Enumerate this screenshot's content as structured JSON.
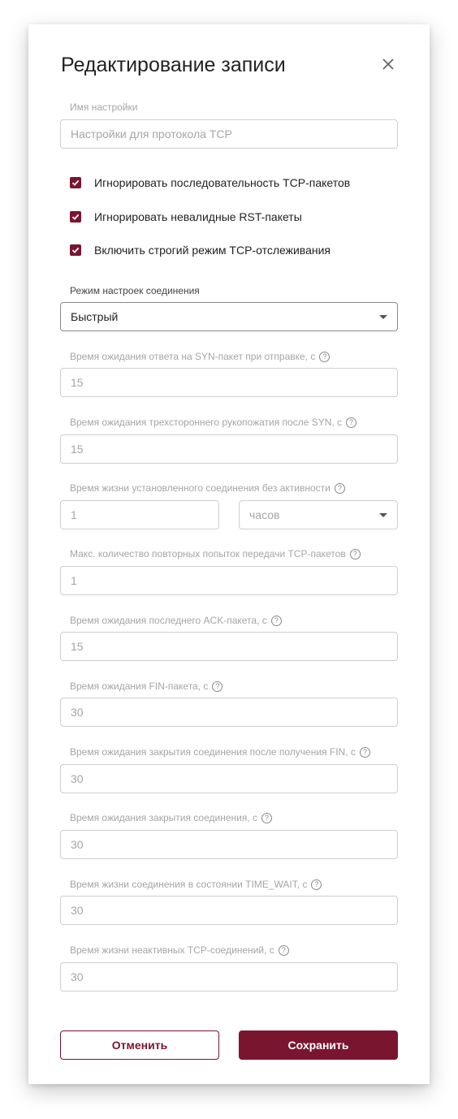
{
  "dialog": {
    "title": "Редактирование записи",
    "close_icon": "close-icon"
  },
  "name_field": {
    "label": "Имя настройки",
    "placeholder": "Настройки для протокола TCP"
  },
  "checkboxes": [
    {
      "label": "Игнорировать последовательность TCP-пакетов",
      "checked": true
    },
    {
      "label": "Игнорировать невалидные RST-пакеты",
      "checked": true
    },
    {
      "label": "Включить строгий режим TCP-отслеживания",
      "checked": true
    }
  ],
  "connection_mode": {
    "label": "Режим настроек соединения",
    "value": "Быстрый"
  },
  "fields": [
    {
      "label": "Время ожидания ответа на SYN-пакет при отправке, с",
      "value": "15"
    },
    {
      "label": "Время ожидания трехстороннего рукопожатия после SYN, с",
      "value": "15"
    },
    {
      "label": "Время жизни установленного соединения без активности",
      "value": "1",
      "unit": "часов"
    },
    {
      "label": "Макс. количество повторных попыток передачи TCP-пакетов",
      "value": "1"
    },
    {
      "label": "Время ожидания последнего ACK-пакета, с",
      "value": "15"
    },
    {
      "label": "Время ожидания FIN-пакета, с",
      "value": "30"
    },
    {
      "label": "Время ожидания закрытия соединения после получения FIN, с",
      "value": "30"
    },
    {
      "label": "Время ожидания закрытия соединения, с",
      "value": "30"
    },
    {
      "label": "Время жизни соединения в состоянии TIME_WAIT, с",
      "value": "30"
    },
    {
      "label": "Время жизни неактивных TCP-соединений, с",
      "value": "30"
    }
  ],
  "help_glyph": "?",
  "buttons": {
    "cancel": "Отменить",
    "save": "Сохранить"
  },
  "colors": {
    "accent": "#7a1530"
  }
}
